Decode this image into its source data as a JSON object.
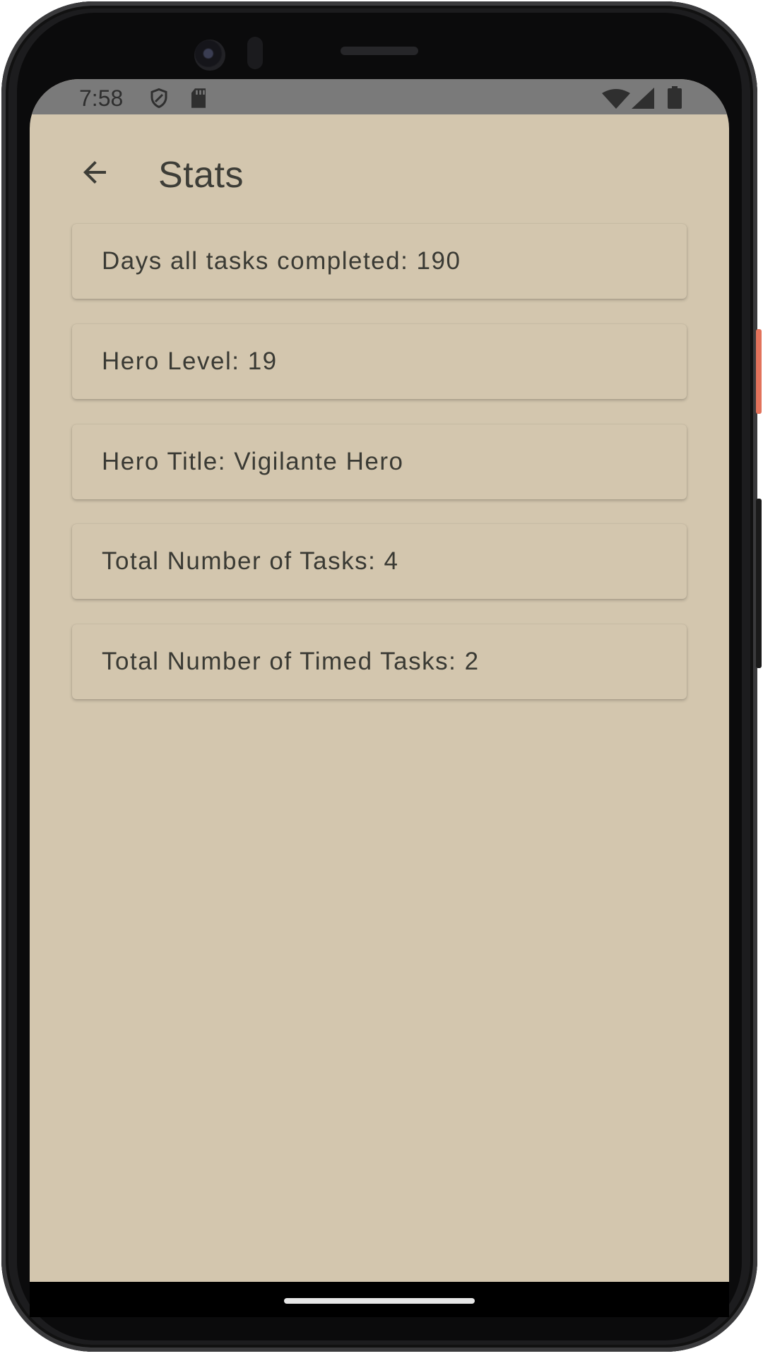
{
  "status_bar": {
    "time": "7:58",
    "left_icons": [
      "shield-icon",
      "sd-card-icon"
    ],
    "right_icons": [
      "wifi-icon",
      "signal-icon",
      "battery-icon"
    ]
  },
  "app_bar": {
    "back_icon": "arrow-back-icon",
    "title": "Stats"
  },
  "stats": [
    {
      "label": "Days all tasks completed: 190"
    },
    {
      "label": "Hero Level: 19"
    },
    {
      "label": "Hero Title: Vigilante Hero"
    },
    {
      "label": "Total Number of Tasks: 4"
    },
    {
      "label": "Total Number of Timed Tasks: 2"
    }
  ],
  "colors": {
    "background": "#d3c6ae",
    "status_bar": "#7a7a7a",
    "text": "#3a3a34"
  }
}
